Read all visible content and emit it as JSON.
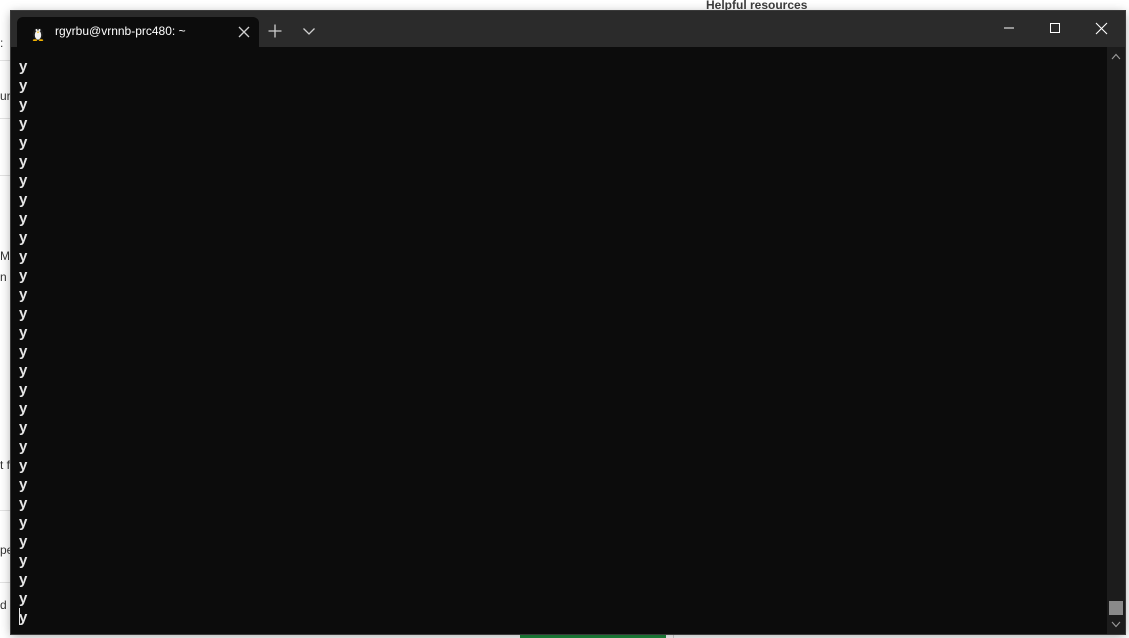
{
  "background": {
    "heading": "Helpful resources",
    "fragments": [
      ":",
      "ur",
      "Mi",
      "n",
      "t f",
      "pe",
      "d"
    ]
  },
  "terminal": {
    "tab": {
      "title": "rgyrbu@vrnnb-prc480: ~",
      "icon": "linux-penguin-icon"
    },
    "buttons": {
      "new_tab": "+",
      "dropdown": "chevron-down-icon",
      "minimize": "minimize-icon",
      "maximize": "maximize-icon",
      "close": "close-icon"
    },
    "output_lines": [
      "y",
      "y",
      "y",
      "y",
      "y",
      "y",
      "y",
      "y",
      "y",
      "y",
      "y",
      "y",
      "y",
      "y",
      "y",
      "y",
      "y",
      "y",
      "y",
      "y",
      "y",
      "y",
      "y",
      "y",
      "y",
      "y",
      "y",
      "y",
      "y",
      "y"
    ],
    "colors": {
      "background": "#0c0c0c",
      "titlebar": "#2b2b2b",
      "text": "#e6e6e6"
    }
  }
}
